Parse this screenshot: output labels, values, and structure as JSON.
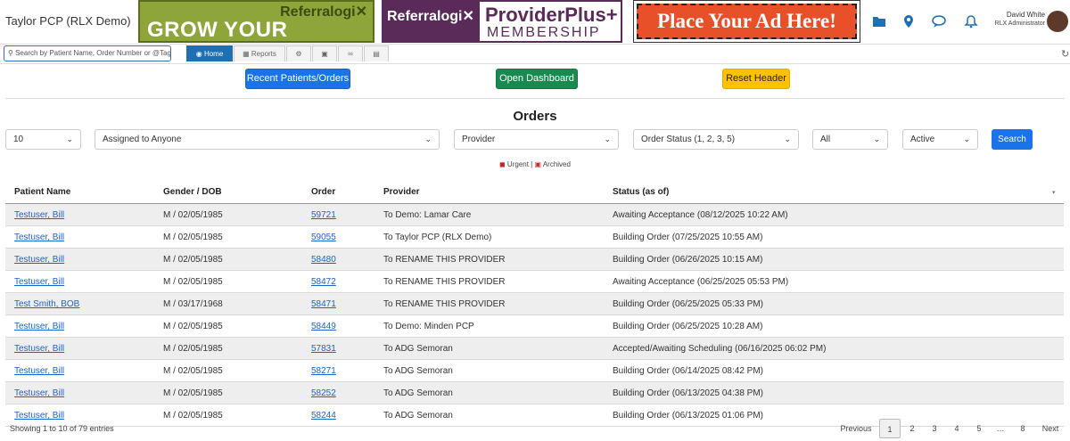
{
  "header": {
    "brand": "Taylor PCP (RLX Demo)",
    "ads": {
      "grow_top": "Referralogi✕",
      "grow_main": "GROW YOUR NETWORK!",
      "provider_left": "Referralogi✕",
      "provider_main": "ProviderPlus+",
      "provider_sub": "MEMBERSHIP",
      "place_ad": "Place Your Ad Here!"
    },
    "icons": [
      "folder-icon",
      "location-pin-icon",
      "chat-icon",
      "bell-icon"
    ],
    "user": {
      "name": "David White",
      "role": "RLX Administrator"
    }
  },
  "nav": {
    "search_placeholder": "Search by Patient Name, Order Number or @Tag",
    "tabs": [
      {
        "label": "Home",
        "icon": "dashboard-icon",
        "active": true
      },
      {
        "label": "Reports",
        "icon": "bar-chart-icon",
        "active": false
      },
      {
        "label": "",
        "icon": "gear-icon",
        "active": false
      },
      {
        "label": "",
        "icon": "truck-icon",
        "active": false
      },
      {
        "label": "",
        "icon": "link-icon",
        "active": false
      },
      {
        "label": "",
        "icon": "id-card-icon",
        "active": false
      }
    ]
  },
  "actions": {
    "recent": "Recent Patients/Orders",
    "dashboard": "Open Dashboard",
    "reset": "Reset Header"
  },
  "orders": {
    "title": "Orders",
    "filters": {
      "page_size": "10",
      "assigned": "Assigned to Anyone",
      "provider": "Provider",
      "status": "Order Status (1, 2, 3, 5)",
      "scope": "All",
      "active": "Active",
      "search_button": "Search"
    },
    "legend": {
      "urgent": "Urgent",
      "archived": "Archived"
    },
    "columns": [
      "Patient Name",
      "Gender / DOB",
      "Order",
      "Provider",
      "Status (as of)"
    ],
    "rows": [
      [
        "Testuser, Bill",
        "M / 02/05/1985",
        "59721",
        "To Demo: Lamar Care",
        "Awaiting Acceptance (08/12/2025 10:22 AM)"
      ],
      [
        "Testuser, Bill",
        "M / 02/05/1985",
        "59055",
        "To Taylor PCP (RLX Demo)",
        "Building Order (07/25/2025 10:55 AM)"
      ],
      [
        "Testuser, Bill",
        "M / 02/05/1985",
        "58480",
        "To RENAME THIS PROVIDER",
        "Building Order (06/26/2025 10:15 AM)"
      ],
      [
        "Testuser, Bill",
        "M / 02/05/1985",
        "58472",
        "To RENAME THIS PROVIDER",
        "Awaiting Acceptance (06/25/2025 05:53 PM)"
      ],
      [
        "Test Smith, BOB",
        "M / 03/17/1968",
        "58471",
        "To RENAME THIS PROVIDER",
        "Building Order (06/25/2025 05:33 PM)"
      ],
      [
        "Testuser, Bill",
        "M / 02/05/1985",
        "58449",
        "To Demo: Minden PCP",
        "Building Order (06/25/2025 10:28 AM)"
      ],
      [
        "Testuser, Bill",
        "M / 02/05/1985",
        "57831",
        "To ADG Semoran",
        "Accepted/Awaiting Scheduling (06/16/2025 06:02 PM)"
      ],
      [
        "Testuser, Bill",
        "M / 02/05/1985",
        "58271",
        "To ADG Semoran",
        "Building Order (06/14/2025 08:42 PM)"
      ],
      [
        "Testuser, Bill",
        "M / 02/05/1985",
        "58252",
        "To ADG Semoran",
        "Building Order (06/13/2025 04:38 PM)"
      ],
      [
        "Testuser, Bill",
        "M / 02/05/1985",
        "58244",
        "To ADG Semoran",
        "Building Order (06/13/2025 01:06 PM)"
      ]
    ],
    "info": "Showing 1 to 10 of 79 entries",
    "pagination": [
      "Previous",
      "1",
      "2",
      "3",
      "4",
      "5",
      "…",
      "8",
      "Next"
    ],
    "current_page": "1"
  }
}
